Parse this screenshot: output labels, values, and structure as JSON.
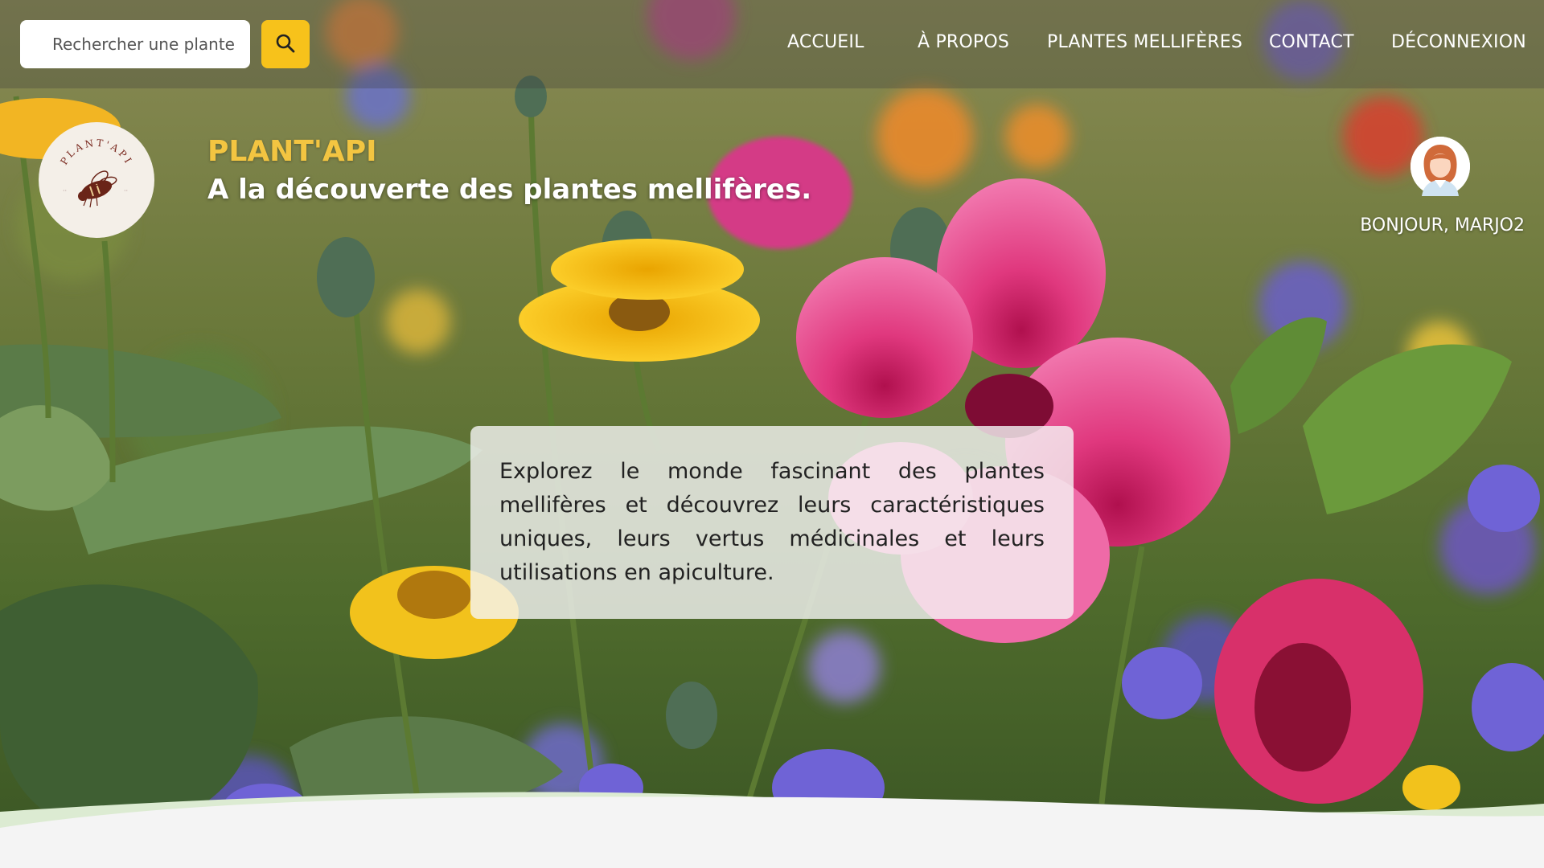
{
  "search": {
    "placeholder": "Rechercher une plante"
  },
  "nav": {
    "items": [
      {
        "label": "ACCUEIL"
      },
      {
        "label": "À PROPOS"
      },
      {
        "label": "PLANTES MELLIFÈRES"
      },
      {
        "label": "CONTACT"
      },
      {
        "label": "DÉCONNEXION"
      }
    ]
  },
  "brand": {
    "name": "PLANT'API",
    "logo_text": "PLANT'API",
    "tagline": "A la découverte des plantes mellifères."
  },
  "user": {
    "greeting": "BONJOUR, MARJO2"
  },
  "intro": {
    "text": "Explorez le monde fascinant des plantes mellifères et découvrez leurs caractéristiques uniques, leurs vertus médicinales et leurs utilisations en apiculture."
  },
  "colors": {
    "accent_yellow": "#f7c21b",
    "brand_gold": "#f3c541",
    "wave_light": "#f4f4f4",
    "wave_green": "#dcebd2"
  },
  "icons": {
    "search": "search-icon",
    "logo": "bee-logo",
    "avatar": "user-avatar"
  }
}
